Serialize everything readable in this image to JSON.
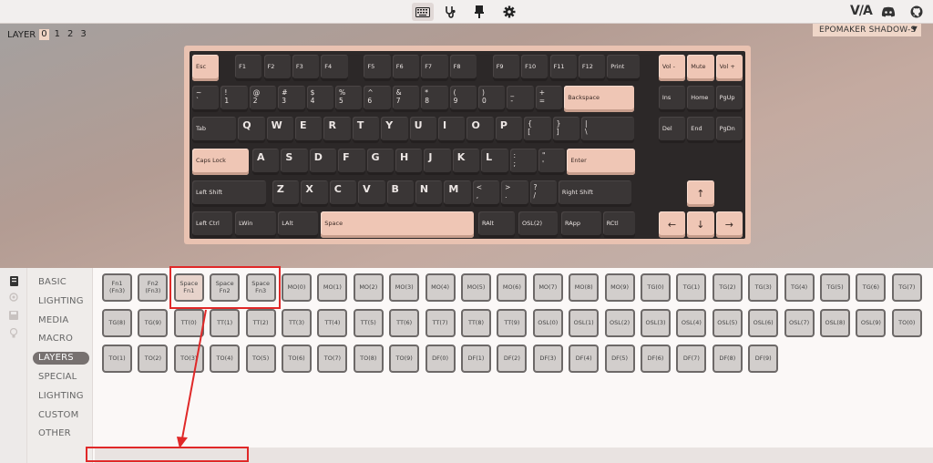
{
  "topbar": {
    "icons": [
      "keyboard-icon",
      "stethoscope-icon",
      "brush-icon",
      "gear-icon"
    ],
    "brand": "V/A",
    "right_icons": [
      "discord-icon",
      "github-icon"
    ]
  },
  "layers": {
    "label": "LAYER",
    "items": [
      "0",
      "1",
      "2",
      "3"
    ],
    "active": "0"
  },
  "device": {
    "name": "EPOMAKER SHADOW-S"
  },
  "keyboard": {
    "row0": [
      "Esc",
      "F1",
      "F2",
      "F3",
      "F4",
      "F5",
      "F6",
      "F7",
      "F8",
      "F9",
      "F10",
      "F11",
      "F12",
      "Print",
      "Vol -",
      "Mute",
      "Vol +"
    ],
    "row1": [
      [
        "~",
        "`"
      ],
      [
        "!",
        "1"
      ],
      [
        "@",
        "2"
      ],
      [
        "#",
        "3"
      ],
      [
        "$",
        "4"
      ],
      [
        "%",
        "5"
      ],
      [
        "^",
        "6"
      ],
      [
        "&",
        "7"
      ],
      [
        "*",
        "8"
      ],
      [
        "(",
        "9"
      ],
      [
        ")",
        "0"
      ],
      [
        "_",
        "-"
      ],
      [
        "+",
        "="
      ],
      "Backspace",
      "Ins",
      "Home",
      "PgUp"
    ],
    "row2": [
      "Tab",
      "Q",
      "W",
      "E",
      "R",
      "T",
      "Y",
      "U",
      "I",
      "O",
      "P",
      [
        "{",
        "["
      ],
      [
        "}",
        "]"
      ],
      [
        "|",
        "\\"
      ],
      "Del",
      "End",
      "PgDn"
    ],
    "row3": [
      "Caps Lock",
      "A",
      "S",
      "D",
      "F",
      "G",
      "H",
      "J",
      "K",
      "L",
      [
        ":",
        ";"
      ],
      [
        "\"",
        "'"
      ],
      "Enter"
    ],
    "row4": [
      "Left Shift",
      "Z",
      "X",
      "C",
      "V",
      "B",
      "N",
      "M",
      [
        "<",
        ","
      ],
      [
        ">",
        "."
      ],
      [
        "?",
        "/"
      ],
      "Right Shift",
      "↑"
    ],
    "row5": [
      "Left Ctrl",
      "LWin",
      "LAlt",
      "Space",
      "RAlt",
      "OSL(2)",
      "RApp",
      "RCtl",
      "←",
      "↓",
      "→"
    ]
  },
  "categories": [
    "BASIC",
    "LIGHTING",
    "MEDIA",
    "MACRO",
    "LAYERS",
    "SPECIAL",
    "LIGHTING",
    "CUSTOM",
    "OTHER"
  ],
  "active_category": "LAYERS",
  "grid_keys": [
    [
      "Fn1 (Fn3)",
      "Fn2 (Fn3)",
      "Space Fn1",
      "Space Fn2",
      "Space Fn3",
      "MO(0)",
      "MO(1)",
      "MO(2)",
      "MO(3)",
      "MO(4)",
      "MO(5)",
      "MO(6)",
      "MO(7)",
      "MO(8)",
      "MO(9)",
      "TG(0)",
      "TG(1)",
      "TG(2)",
      "TG(3)",
      "TG(4)",
      "TG(5)",
      "TG(6)",
      "TG(7)"
    ],
    [
      "TG(8)",
      "TG(9)",
      "TT(0)",
      "TT(1)",
      "TT(2)",
      "TT(3)",
      "TT(4)",
      "TT(5)",
      "TT(6)",
      "TT(7)",
      "TT(8)",
      "TT(9)",
      "OSL(0)",
      "OSL(1)",
      "OSL(2)",
      "OSL(3)",
      "OSL(4)",
      "OSL(5)",
      "OSL(6)",
      "OSL(7)",
      "OSL(8)",
      "OSL(9)",
      "TO(0)"
    ],
    [
      "TO(1)",
      "TO(2)",
      "TO(3)",
      "TO(4)",
      "TO(5)",
      "TO(6)",
      "TO(7)",
      "TO(8)",
      "TO(9)",
      "DF(0)",
      "DF(1)",
      "DF(2)",
      "DF(3)",
      "DF(4)",
      "DF(5)",
      "DF(6)",
      "DF(7)",
      "DF(8)",
      "DF(9)"
    ]
  ],
  "status": {
    "text": ""
  },
  "colors": {
    "accent": "#efc6b5",
    "plate": "#2c2828",
    "highlight": "#e02828",
    "sidebar_active": "#777170"
  }
}
